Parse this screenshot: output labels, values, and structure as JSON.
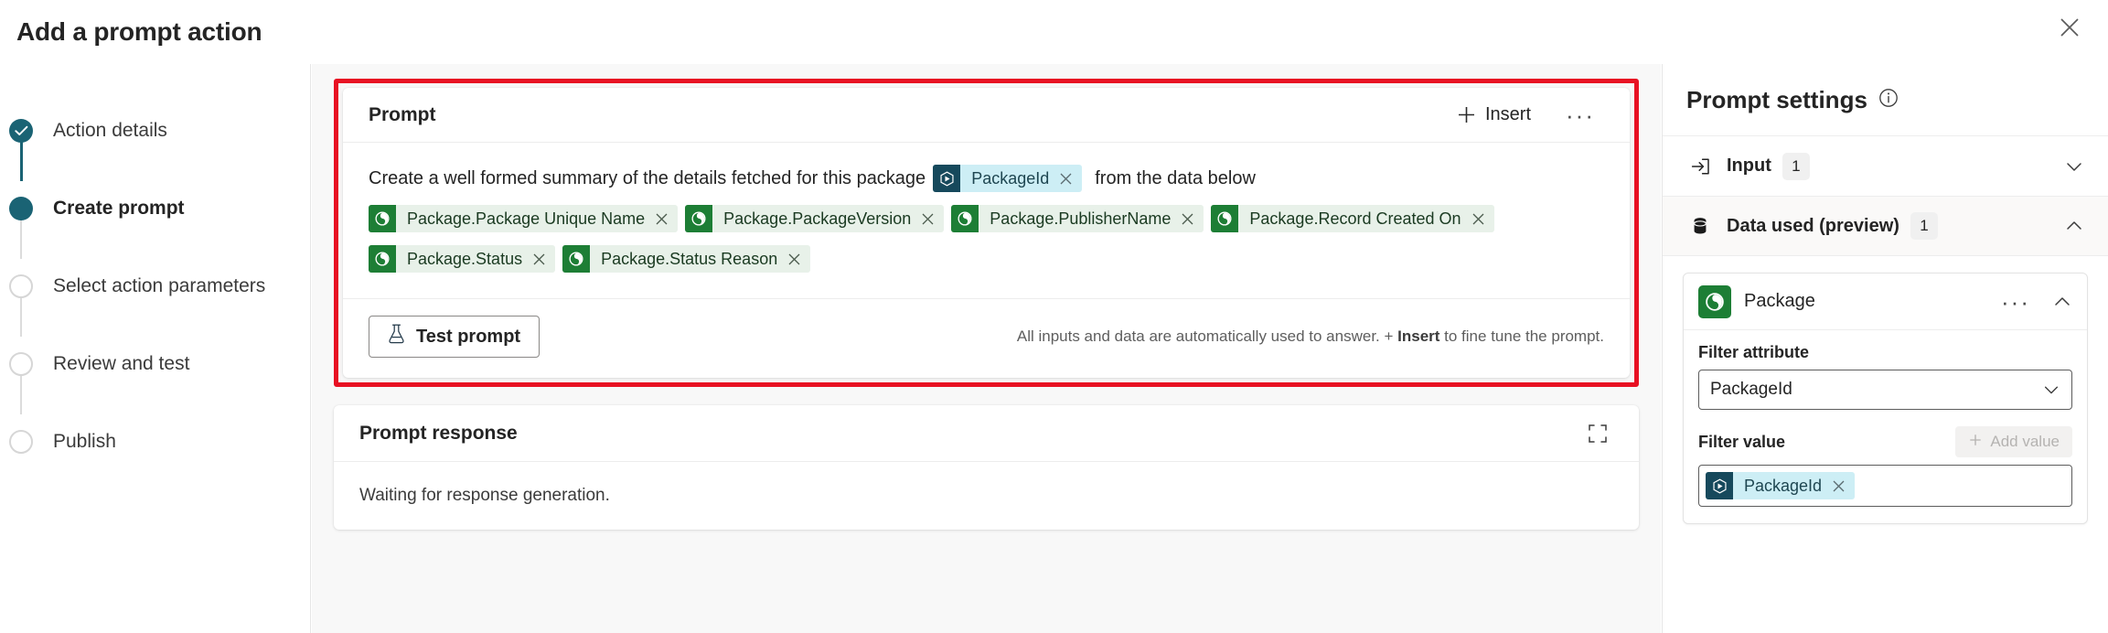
{
  "window": {
    "title": "Add a prompt action",
    "close_icon": "close-icon"
  },
  "wizard": {
    "steps": [
      {
        "label": "Action details",
        "state": "done"
      },
      {
        "label": "Create prompt",
        "state": "current"
      },
      {
        "label": "Select action parameters",
        "state": "todo"
      },
      {
        "label": "Review and test",
        "state": "todo"
      },
      {
        "label": "Publish",
        "state": "todo"
      }
    ]
  },
  "prompt_card": {
    "title": "Prompt",
    "insert_label": "Insert",
    "insert_icon": "plus-icon",
    "more_icon": "ellipsis-icon",
    "text_before": "Create a well formed summary of the details fetched for this package",
    "inline_chip": {
      "label": "PackageId",
      "type": "blue",
      "icon": "input-token-icon",
      "remove_icon": "close-icon"
    },
    "text_after": "from the data below",
    "chips": [
      {
        "label": "Package.Package Unique Name",
        "type": "green",
        "icon": "dataverse-table-icon",
        "remove_icon": "close-icon"
      },
      {
        "label": "Package.PackageVersion",
        "type": "green",
        "icon": "dataverse-table-icon",
        "remove_icon": "close-icon"
      },
      {
        "label": "Package.PublisherName",
        "type": "green",
        "icon": "dataverse-table-icon",
        "remove_icon": "close-icon"
      },
      {
        "label": "Package.Record Created On",
        "type": "green",
        "icon": "dataverse-table-icon",
        "remove_icon": "close-icon"
      },
      {
        "label": "Package.Status",
        "type": "green",
        "icon": "dataverse-table-icon",
        "remove_icon": "close-icon"
      },
      {
        "label": "Package.Status Reason",
        "type": "green",
        "icon": "dataverse-table-icon",
        "remove_icon": "close-icon"
      }
    ],
    "test_button": {
      "label": "Test prompt",
      "icon": "flask-icon"
    },
    "hint_part1": "All inputs and data are automatically used to answer. + ",
    "hint_bold": "Insert",
    "hint_part2": " to fine tune the prompt.",
    "highlight_color": "#e81123"
  },
  "response_card": {
    "title": "Prompt response",
    "expand_icon": "expand-icon",
    "body_text": "Waiting for response generation."
  },
  "settings": {
    "title": "Prompt settings",
    "info_icon": "info-icon",
    "sections": [
      {
        "label": "Input",
        "badge": "1",
        "icon": "input-arrow-icon",
        "chevron": "chevron-down-icon",
        "expanded": false
      },
      {
        "label": "Data used (preview)",
        "badge": "1",
        "icon": "database-icon",
        "chevron": "chevron-up-icon",
        "expanded": true
      }
    ],
    "data_card": {
      "entity_name": "Package",
      "entity_icon": "dataverse-table-icon",
      "more_icon": "ellipsis-icon",
      "chevron": "chevron-up-icon",
      "filter_attribute_label": "Filter attribute",
      "filter_attribute_value": "PackageId",
      "filter_attribute_chevron": "chevron-down-icon",
      "filter_value_label": "Filter value",
      "add_value_label": "Add value",
      "add_value_icon": "plus-icon",
      "filter_value_chip": {
        "label": "PackageId",
        "type": "blue",
        "icon": "input-token-icon",
        "remove_icon": "close-icon"
      }
    }
  },
  "colors": {
    "accent_teal": "#1a6374",
    "chip_green_bg": "#e8f1e9",
    "chip_green_icon": "#1d7e35",
    "chip_blue_bg": "#cdeef5",
    "chip_blue_icon": "#16495c",
    "highlight_red": "#e81123",
    "panel_bg": "#f8f8f8"
  }
}
